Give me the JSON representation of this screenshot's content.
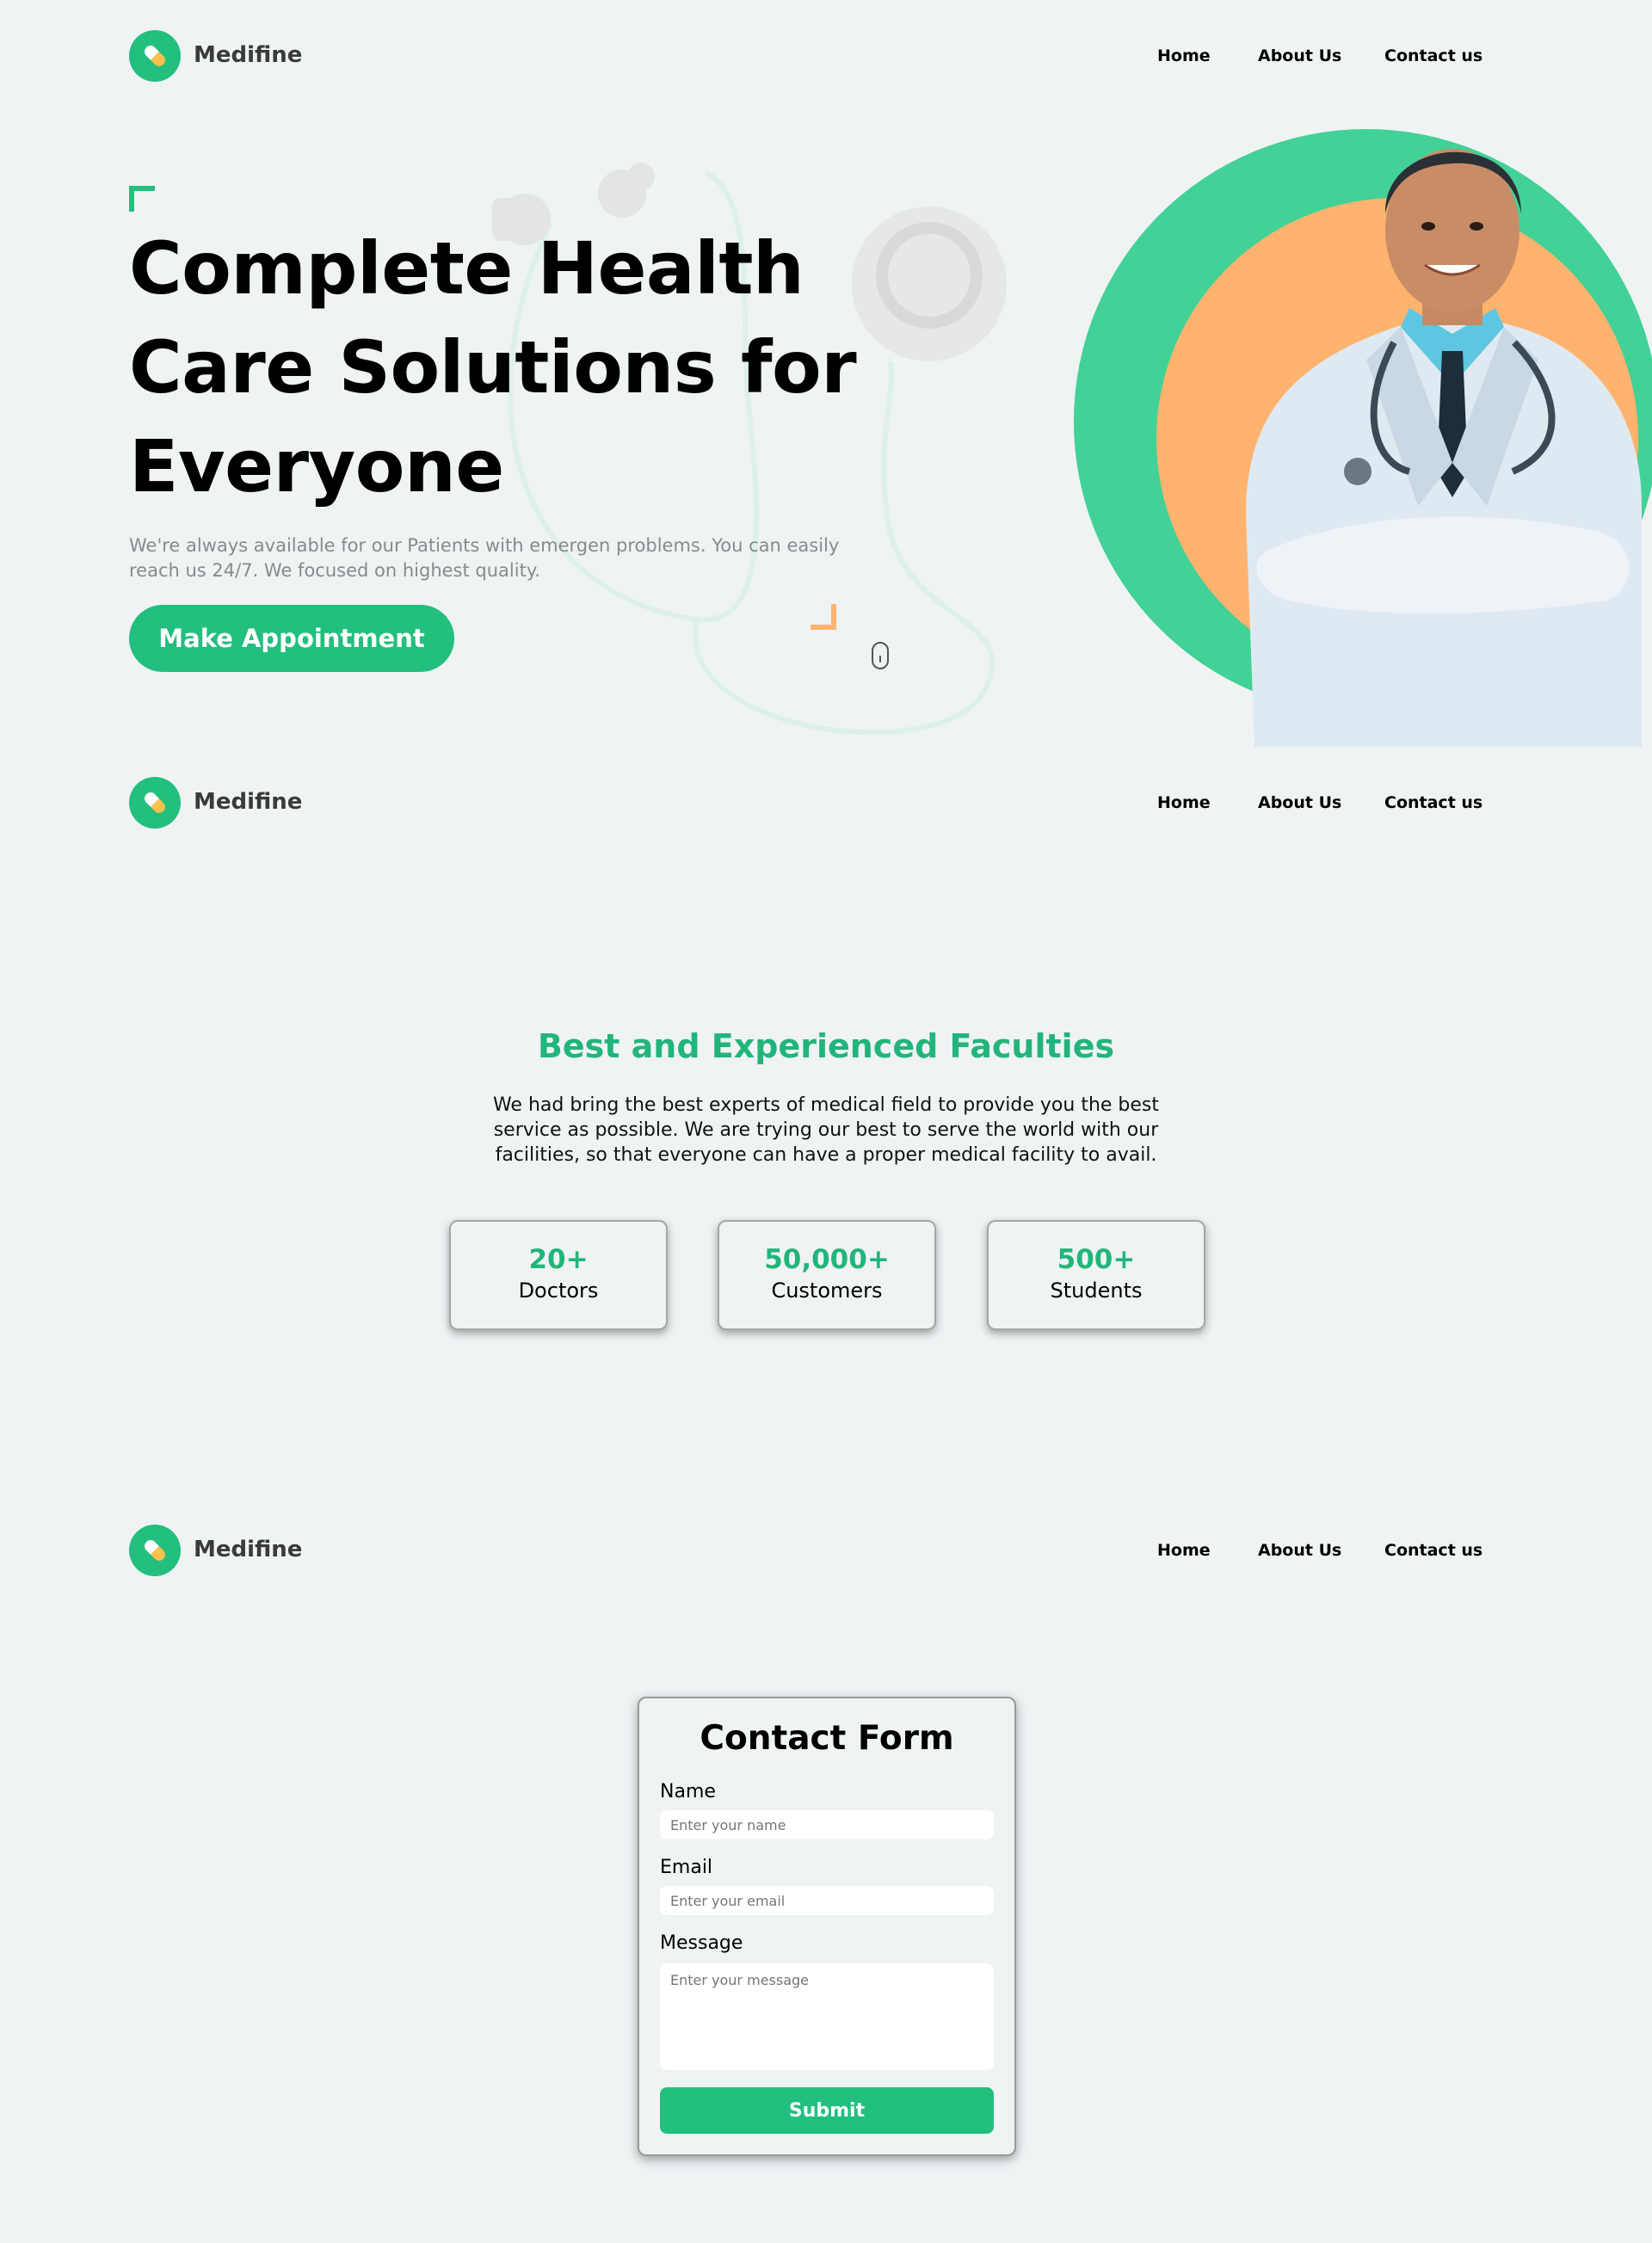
{
  "brand": {
    "name": "Medifine",
    "accent": "#22bf7e",
    "secondary": "#ffb36e"
  },
  "nav": {
    "home": "Home",
    "about": "About Us",
    "contact": "Contact us"
  },
  "hero": {
    "title_line1": "Complete Health",
    "title_line2": "Care Solutions for",
    "title_line3": "Everyone",
    "subtitle": "We're always available for our Patients with emergen problems. You can easily reach us 24/7. We focused on highest quality.",
    "cta": "Make Appointment",
    "image_icon": "doctor-portrait"
  },
  "faculties": {
    "title": "Best and Experienced Faculties",
    "description": "We had bring the best experts of medical field to provide you the best service as possible. We are trying our best to serve the world with our facilities, so that everyone can have a proper medical facility to avail.",
    "stats": [
      {
        "value": "20+",
        "label": "Doctors"
      },
      {
        "value": "50,000+",
        "label": "Customers"
      },
      {
        "value": "500+",
        "label": "Students"
      }
    ]
  },
  "contact_form": {
    "title": "Contact Form",
    "name_label": "Name",
    "name_placeholder": "Enter your name",
    "email_label": "Email",
    "email_placeholder": "Enter your email",
    "message_label": "Message",
    "message_placeholder": "Enter your message",
    "submit": "Submit"
  }
}
